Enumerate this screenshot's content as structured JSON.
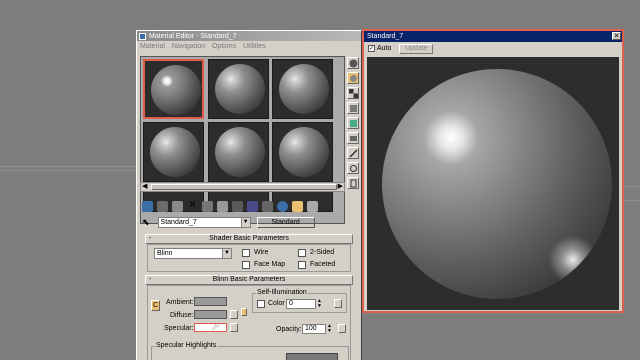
{
  "material_editor": {
    "title": "Material Editor - Standard_7",
    "menu": [
      "Material",
      "Navigation",
      "Options",
      "Utilities"
    ],
    "material_name": "Standard_7",
    "material_type_button": "Standard",
    "shader_rollout": {
      "title": "Shader Basic Parameters",
      "shader_value": "Blinn",
      "wire_label": "Wire",
      "two_sided_label": "2-Sided",
      "face_map_label": "Face Map",
      "faceted_label": "Faceted"
    },
    "blinn_rollout": {
      "title": "Blinn Basic Parameters",
      "self_illum_label": "Self-Illumination",
      "color_label": "Color",
      "color_value": "0",
      "ambient_label": "Ambient:",
      "diffuse_label": "Diffuse:",
      "specular_label": "Specular:",
      "lock_label": "C",
      "opacity_label": "Opacity:",
      "opacity_value": "100",
      "specular_highlights_label": "Specular Highlights"
    },
    "colors": {
      "ambient": "#9a9a9a",
      "diffuse": "#9a9a9a",
      "specular": "#ffffff",
      "active_slot_border": "#e05b4a"
    }
  },
  "preview_window": {
    "title": "Standard_7",
    "auto_label": "Auto",
    "auto_checked": true,
    "update_label": "Update",
    "close_icon": "close-icon"
  }
}
